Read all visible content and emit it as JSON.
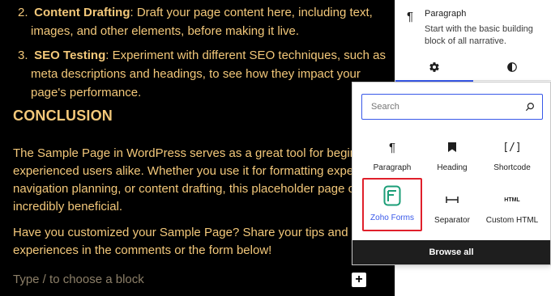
{
  "editor": {
    "list": [
      {
        "num": "2.",
        "bold": "Content Drafting",
        "text": ": Draft your page content here, including text, images, and other elements, before making it live."
      },
      {
        "num": "3.",
        "bold": "SEO Testing",
        "text": ": Experiment with different SEO techniques, such as meta descriptions and headings, to see how they impact your page's performance."
      }
    ],
    "conclusion_heading": "CONCLUSION",
    "paragraph1": "The Sample Page in WordPress serves as a great tool for beginners and experienced users alike. Whether you use it for formatting experiments, navigation planning, or content drafting, this placeholder page can be incredibly beneficial.",
    "paragraph2": "Have you customized your Sample Page? Share your tips and experiences in the comments or the form below!",
    "placeholder": "Type / to choose a block",
    "add_block": "+"
  },
  "sidebar": {
    "block_icon": "pilcrow-icon",
    "block_title": "Paragraph",
    "block_description": "Start with the basic building block of all narrative.",
    "tabs": [
      {
        "name": "settings",
        "icon": "gear-icon",
        "active": true
      },
      {
        "name": "styles",
        "icon": "half-circle-icon",
        "active": false
      }
    ]
  },
  "inserter": {
    "search_placeholder": "Search",
    "blocks": [
      {
        "label": "Paragraph",
        "icon": "pilcrow-icon"
      },
      {
        "label": "Heading",
        "icon": "bookmark-icon"
      },
      {
        "label": "Shortcode",
        "icon": "shortcode-icon",
        "glyph": "[/]"
      },
      {
        "label": "Zoho Forms",
        "icon": "zoho-forms-icon",
        "selected": true
      },
      {
        "label": "Separator",
        "icon": "separator-icon"
      },
      {
        "label": "Custom HTML",
        "icon": "html-icon",
        "glyph": "HTML"
      }
    ],
    "browse_all": "Browse all"
  },
  "colors": {
    "text_gold": "#f3c87a",
    "accent_blue": "#3858e9",
    "selection_red": "#e0202b",
    "zoho_green": "#1b9e77"
  }
}
